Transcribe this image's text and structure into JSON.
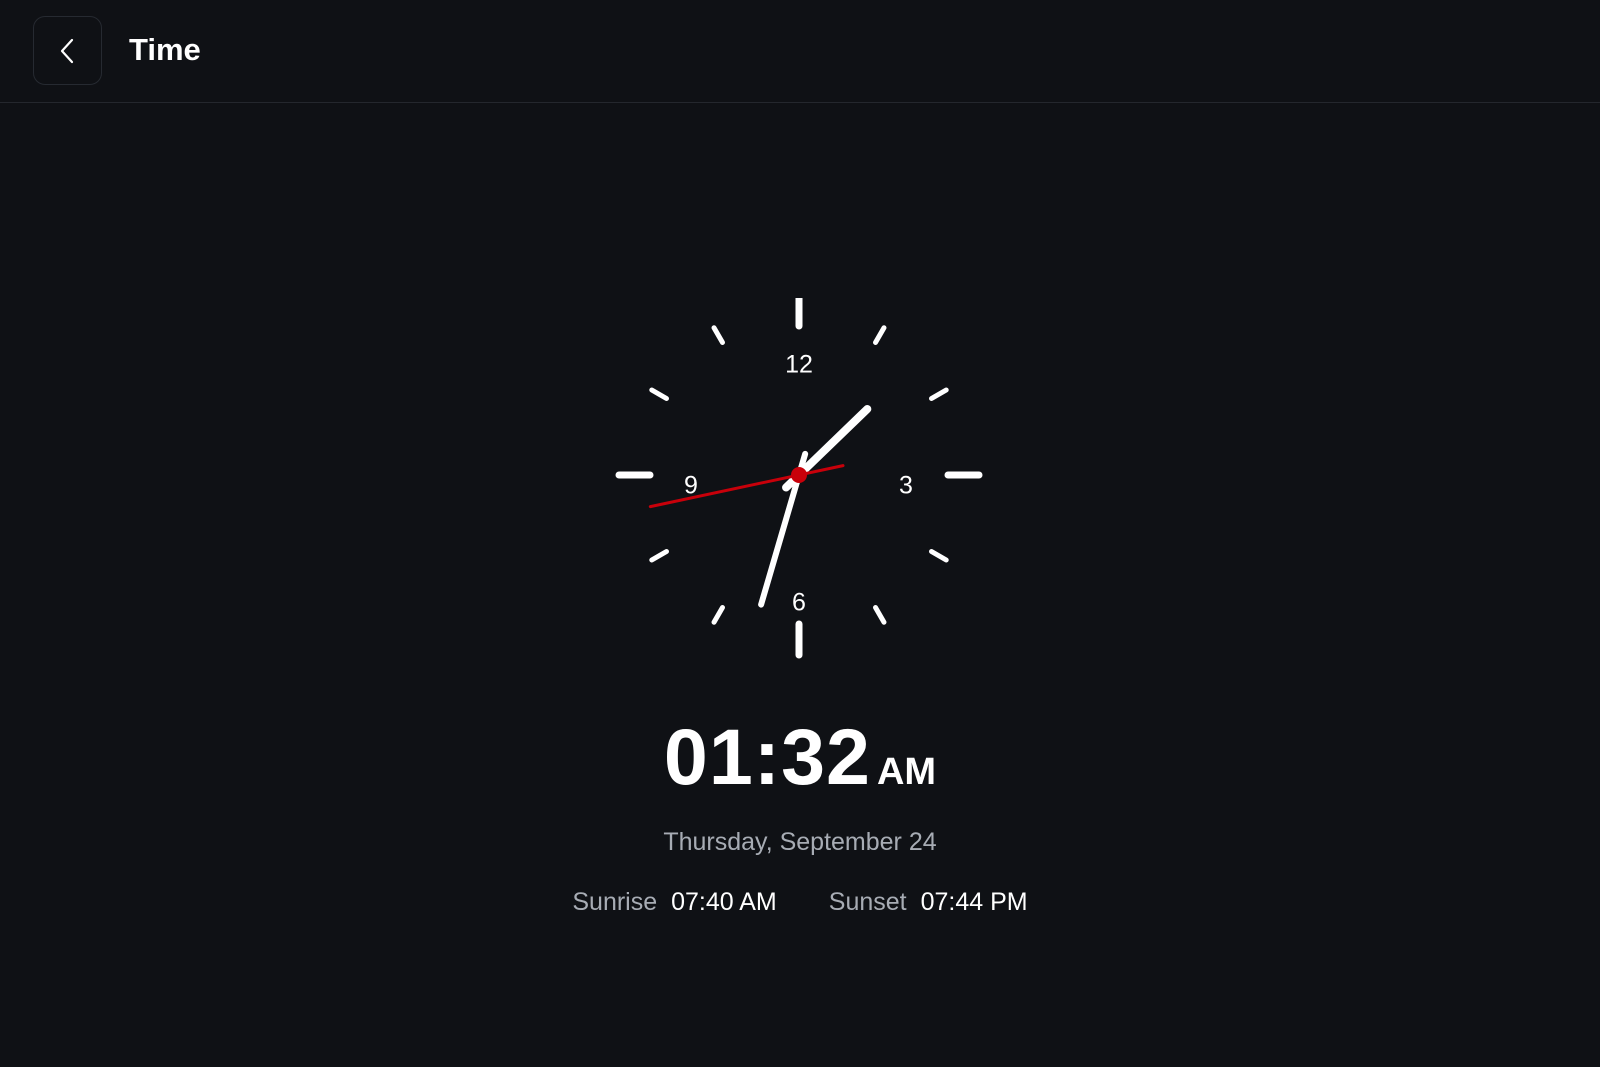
{
  "header": {
    "back_icon": "chevron-left-icon",
    "title": "Time"
  },
  "clock": {
    "numerals": [
      "12",
      "3",
      "6",
      "9"
    ],
    "hour": 1,
    "minute": 32,
    "second": 43,
    "colors": {
      "hands": "#ffffff",
      "second_hand": "#c8000a",
      "ticks": "#ffffff"
    }
  },
  "time": {
    "digits": "01:32",
    "period": "AM"
  },
  "date": "Thursday, September 24",
  "sun": {
    "sunrise_label": "Sunrise",
    "sunrise_value": "07:40 AM",
    "sunset_label": "Sunset",
    "sunset_value": "07:44 PM"
  },
  "colors": {
    "background": "#0f1115",
    "muted_text": "#a7acb4"
  }
}
